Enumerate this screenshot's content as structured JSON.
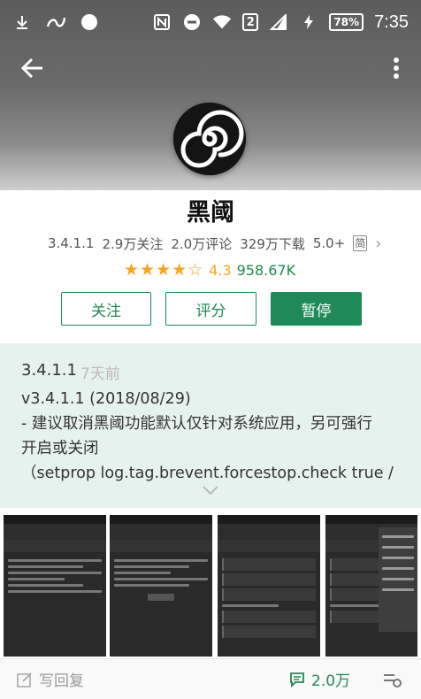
{
  "status_bar": {
    "time": "7:35",
    "battery": "78%",
    "notification_count": "2"
  },
  "app": {
    "name": "黑阈",
    "version": "3.4.1.1",
    "followers": "2.9万关注",
    "reviews": "2.0万评论",
    "downloads": "329万下载",
    "age_rating": "5.0+",
    "lang_badge": "简",
    "rating": "4.3",
    "rating_count": "958.67K",
    "rating_fraction": 0.86
  },
  "actions": {
    "follow_label": "关注",
    "rate_label": "评分",
    "pause_label": "暂停"
  },
  "update": {
    "version": "3.4.1.1",
    "date": "7天前",
    "lines": [
      "v3.4.1.1 (2018/08/29)",
      "- 建议取消黑阈功能默认仅针对系统应用，另可强行",
      "开启或关闭",
      "（setprop log.tag.brevent.forcestop.check true /"
    ]
  },
  "bottom_bar": {
    "reply_label": "写回复",
    "comment_count": "2.0万"
  },
  "colors": {
    "accent": "#1e8a57",
    "star": "#f5a623",
    "update_bg": "#e6f2ee"
  }
}
